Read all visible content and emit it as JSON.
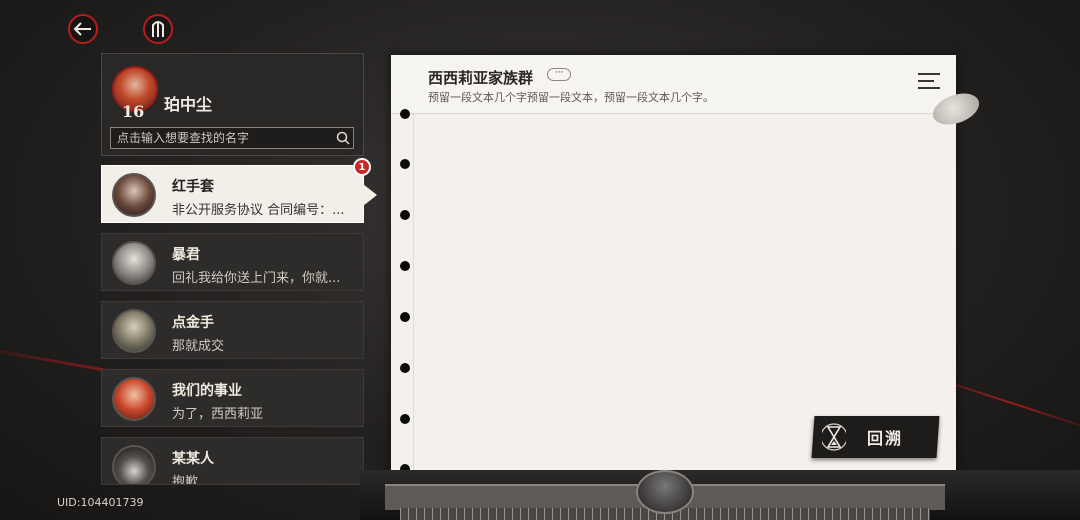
{
  "nav": {
    "back_icon": "back-arrow-icon",
    "home_icon": "emblem-icon"
  },
  "profile": {
    "name": "珀中尘",
    "level": "16"
  },
  "search": {
    "placeholder": "点击输入想要查找的名字",
    "icon": "search-icon"
  },
  "contacts": [
    {
      "name": "红手套",
      "message": "非公开服务协议 合同编号：...",
      "unread": "1",
      "active": true
    },
    {
      "name": "暴君",
      "message": "回礼我给你送上门来，你就...",
      "active": false
    },
    {
      "name": "点金手",
      "message": "那就成交",
      "active": false
    },
    {
      "name": "我们的事业",
      "message": "为了，西西莉亚",
      "active": false
    },
    {
      "name": "某某人",
      "message": "抱歉",
      "active": false
    }
  ],
  "uid": "UID:104401739",
  "chat": {
    "group_name": "西西莉亚家族群",
    "more_label": "···",
    "description": "预留一段文本几个字预留一段文本，预留一段文本几个字。",
    "menu_icon": "menu-icon"
  },
  "replay": {
    "label": "回溯",
    "icon": "hourglass-icon"
  },
  "colors": {
    "accent_red": "#b71c1c",
    "paper": "#f4f1ec",
    "panel": "#2e2c2b"
  }
}
